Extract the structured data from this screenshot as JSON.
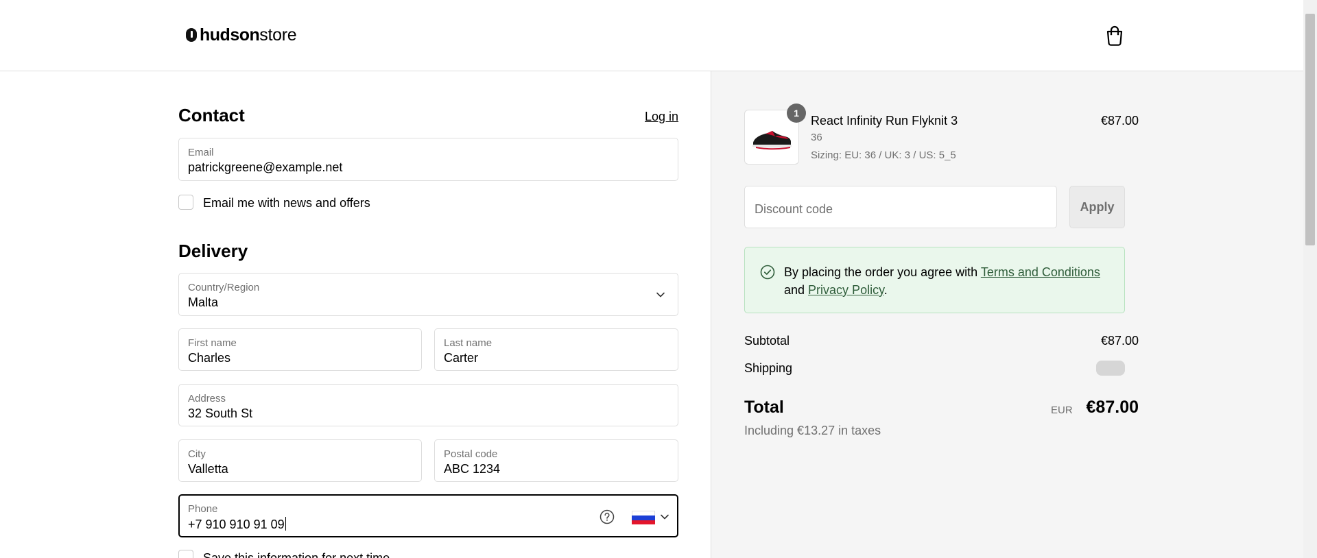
{
  "header": {
    "logo_bold": "hudson",
    "logo_light": "store",
    "cart_icon": "shopping-bag-icon"
  },
  "contact": {
    "title": "Contact",
    "login_link": "Log in",
    "email": {
      "label": "Email",
      "value": "patrickgreene@example.net"
    },
    "newsletter_label": "Email me with news and offers"
  },
  "delivery": {
    "title": "Delivery",
    "country": {
      "label": "Country/Region",
      "value": "Malta",
      "icon": "chevron-down-icon"
    },
    "first_name": {
      "label": "First name",
      "value": "Charles"
    },
    "last_name": {
      "label": "Last name",
      "value": "Carter"
    },
    "address": {
      "label": "Address",
      "value": "32 South St"
    },
    "city": {
      "label": "City",
      "value": "Valletta"
    },
    "postal_code": {
      "label": "Postal code",
      "value": "ABC 1234"
    },
    "phone": {
      "label": "Phone",
      "value": "+7 910 910 91 09",
      "help_icon": "question-circle-icon",
      "flag_icon": "russia-flag-icon"
    },
    "save_info_label": "Save this information for next time"
  },
  "summary": {
    "product": {
      "quantity": "1",
      "name": "React Infinity Run Flyknit 3",
      "size": "36",
      "sizing": "Sizing: EU: 36 / UK: 3 / US: 5_5",
      "price": "€87.00"
    },
    "discount": {
      "placeholder": "Discount code",
      "apply_label": "Apply"
    },
    "notice": {
      "icon": "check-circle-icon",
      "text_before": "By placing the order you agree with ",
      "terms_link": "Terms and Conditions",
      "text_middle": "and ",
      "privacy_link": "Privacy Policy",
      "text_after": "."
    },
    "subtotal_label": "Subtotal",
    "subtotal_value": "€87.00",
    "shipping_label": "Shipping",
    "total_label": "Total",
    "total_currency": "EUR",
    "total_value": "€87.00",
    "taxes_text": "Including €13.27 in taxes"
  },
  "colors": {
    "notice_bg": "#eaf7ec",
    "notice_border": "#b7e2bf",
    "link_green": "#2f5d3a",
    "panel_bg": "#f5f5f5"
  }
}
